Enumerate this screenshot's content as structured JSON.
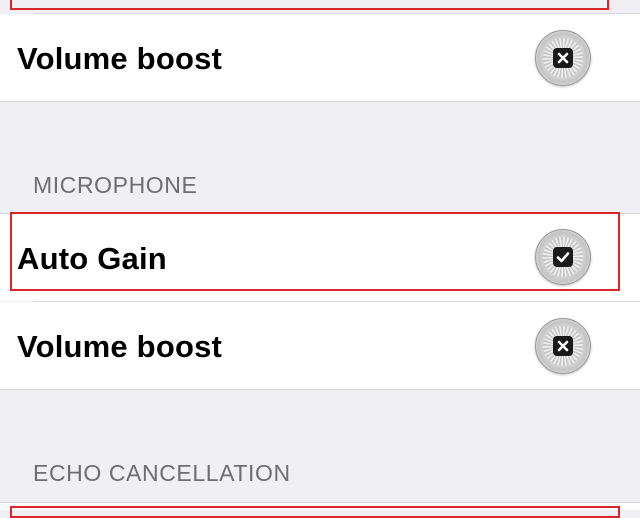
{
  "sections": [
    {
      "rows": [
        {
          "label": "Volume boost",
          "state": "unchecked",
          "icon": "x-mark-icon"
        }
      ]
    },
    {
      "header": "MICROPHONE",
      "rows": [
        {
          "label": "Auto Gain",
          "state": "checked",
          "icon": "checkmark-icon"
        },
        {
          "label": "Volume boost",
          "state": "unchecked",
          "icon": "x-mark-icon"
        }
      ]
    },
    {
      "header": "ECHO CANCELLATION"
    }
  ],
  "colors": {
    "background": "#efeff4",
    "row_background": "#ffffff",
    "header_text": "#6d6d72",
    "highlight": "#d9262b",
    "separator": "#d6d6da"
  }
}
